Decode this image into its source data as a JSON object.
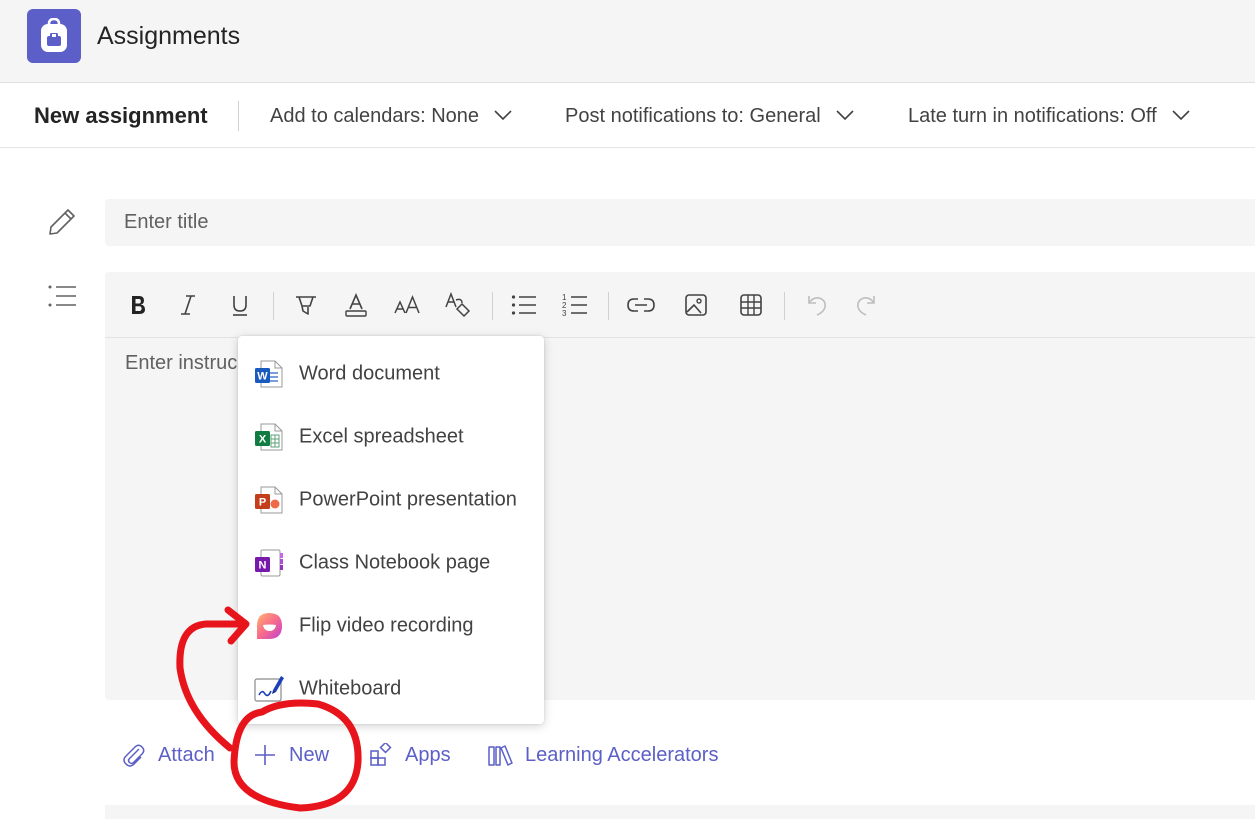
{
  "app": {
    "title": "Assignments",
    "logo_icon": "backpack-icon",
    "accent_color": "#5b5fc7"
  },
  "toolbar": {
    "title": "New assignment",
    "calendars": "Add to calendars: None",
    "notifications": "Post notifications to: General",
    "late_notifications": "Late turn in notifications: Off"
  },
  "form": {
    "title_placeholder": "Enter title",
    "instructions_placeholder": "Enter instruc"
  },
  "formatting_tools": [
    "bold-icon",
    "italic-icon",
    "underline-icon",
    "highlight-icon",
    "font-color-icon",
    "font-size-icon",
    "clear-format-icon",
    "bullet-list-icon",
    "numbered-list-icon",
    "link-icon",
    "image-icon",
    "table-icon",
    "undo-icon",
    "redo-icon"
  ],
  "new_menu": {
    "items": [
      {
        "label": "Word document",
        "icon": "word-icon",
        "color": "#185abd"
      },
      {
        "label": "Excel spreadsheet",
        "icon": "excel-icon",
        "color": "#107c41"
      },
      {
        "label": "PowerPoint presentation",
        "icon": "powerpoint-icon",
        "color": "#c43e1c"
      },
      {
        "label": "Class Notebook page",
        "icon": "onenote-icon",
        "color": "#7719aa"
      },
      {
        "label": "Flip video recording",
        "icon": "flip-icon",
        "color": "#f0588d"
      },
      {
        "label": "Whiteboard",
        "icon": "whiteboard-icon",
        "color": "#1a3fb8"
      }
    ]
  },
  "actions": {
    "attach": "Attach",
    "new": "New",
    "apps": "Apps",
    "learning_accelerators": "Learning Accelerators"
  },
  "annotation_color": "#e8141b"
}
